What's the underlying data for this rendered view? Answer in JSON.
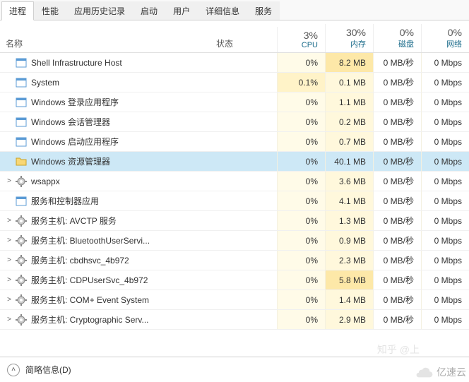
{
  "tabs": [
    {
      "label": "进程",
      "active": true
    },
    {
      "label": "性能",
      "active": false
    },
    {
      "label": "应用历史记录",
      "active": false
    },
    {
      "label": "启动",
      "active": false
    },
    {
      "label": "用户",
      "active": false
    },
    {
      "label": "详细信息",
      "active": false
    },
    {
      "label": "服务",
      "active": false
    }
  ],
  "columns": {
    "name": "名称",
    "status": "状态",
    "cpu": {
      "pct": "3%",
      "label": "CPU"
    },
    "mem": {
      "pct": "30%",
      "label": "内存"
    },
    "disk": {
      "pct": "0%",
      "label": "磁盘"
    },
    "net": {
      "pct": "0%",
      "label": "网络"
    }
  },
  "rows": [
    {
      "expander": "",
      "icon": "window-icon",
      "name": "Shell Infrastructure Host",
      "cpu": "0%",
      "mem": "8.2 MB",
      "disk": "0 MB/秒",
      "net": "0 Mbps",
      "selected": false
    },
    {
      "expander": "",
      "icon": "window-icon",
      "name": "System",
      "cpu": "0.1%",
      "mem": "0.1 MB",
      "disk": "0 MB/秒",
      "net": "0 Mbps",
      "selected": false
    },
    {
      "expander": "",
      "icon": "window-icon",
      "name": "Windows 登录应用程序",
      "cpu": "0%",
      "mem": "1.1 MB",
      "disk": "0 MB/秒",
      "net": "0 Mbps",
      "selected": false
    },
    {
      "expander": "",
      "icon": "window-icon",
      "name": "Windows 会话管理器",
      "cpu": "0%",
      "mem": "0.2 MB",
      "disk": "0 MB/秒",
      "net": "0 Mbps",
      "selected": false
    },
    {
      "expander": "",
      "icon": "window-icon",
      "name": "Windows 启动应用程序",
      "cpu": "0%",
      "mem": "0.7 MB",
      "disk": "0 MB/秒",
      "net": "0 Mbps",
      "selected": false
    },
    {
      "expander": "",
      "icon": "folder-icon",
      "name": "Windows 资源管理器",
      "cpu": "0%",
      "mem": "40.1 MB",
      "disk": "0 MB/秒",
      "net": "0 Mbps",
      "selected": true
    },
    {
      "expander": ">",
      "icon": "gear-icon",
      "name": "wsappx",
      "cpu": "0%",
      "mem": "3.6 MB",
      "disk": "0 MB/秒",
      "net": "0 Mbps",
      "selected": false
    },
    {
      "expander": "",
      "icon": "window-icon",
      "name": "服务和控制器应用",
      "cpu": "0%",
      "mem": "4.1 MB",
      "disk": "0 MB/秒",
      "net": "0 Mbps",
      "selected": false
    },
    {
      "expander": ">",
      "icon": "gear-icon",
      "name": "服务主机: AVCTP 服务",
      "cpu": "0%",
      "mem": "1.3 MB",
      "disk": "0 MB/秒",
      "net": "0 Mbps",
      "selected": false
    },
    {
      "expander": ">",
      "icon": "gear-icon",
      "name": "服务主机: BluetoothUserServi...",
      "cpu": "0%",
      "mem": "0.9 MB",
      "disk": "0 MB/秒",
      "net": "0 Mbps",
      "selected": false
    },
    {
      "expander": ">",
      "icon": "gear-icon",
      "name": "服务主机: cbdhsvc_4b972",
      "cpu": "0%",
      "mem": "2.3 MB",
      "disk": "0 MB/秒",
      "net": "0 Mbps",
      "selected": false
    },
    {
      "expander": ">",
      "icon": "gear-icon",
      "name": "服务主机: CDPUserSvc_4b972",
      "cpu": "0%",
      "mem": "5.8 MB",
      "disk": "0 MB/秒",
      "net": "0 Mbps",
      "selected": false
    },
    {
      "expander": ">",
      "icon": "gear-icon",
      "name": "服务主机: COM+ Event System",
      "cpu": "0%",
      "mem": "1.4 MB",
      "disk": "0 MB/秒",
      "net": "0 Mbps",
      "selected": false
    },
    {
      "expander": ">",
      "icon": "gear-icon",
      "name": "服务主机: Cryptographic Serv...",
      "cpu": "0%",
      "mem": "2.9 MB",
      "disk": "0 MB/秒",
      "net": "0 Mbps",
      "selected": false
    }
  ],
  "footer": {
    "less_info": "简略信息(D)"
  },
  "watermark1": "知乎 @上",
  "watermark2": "亿速云"
}
